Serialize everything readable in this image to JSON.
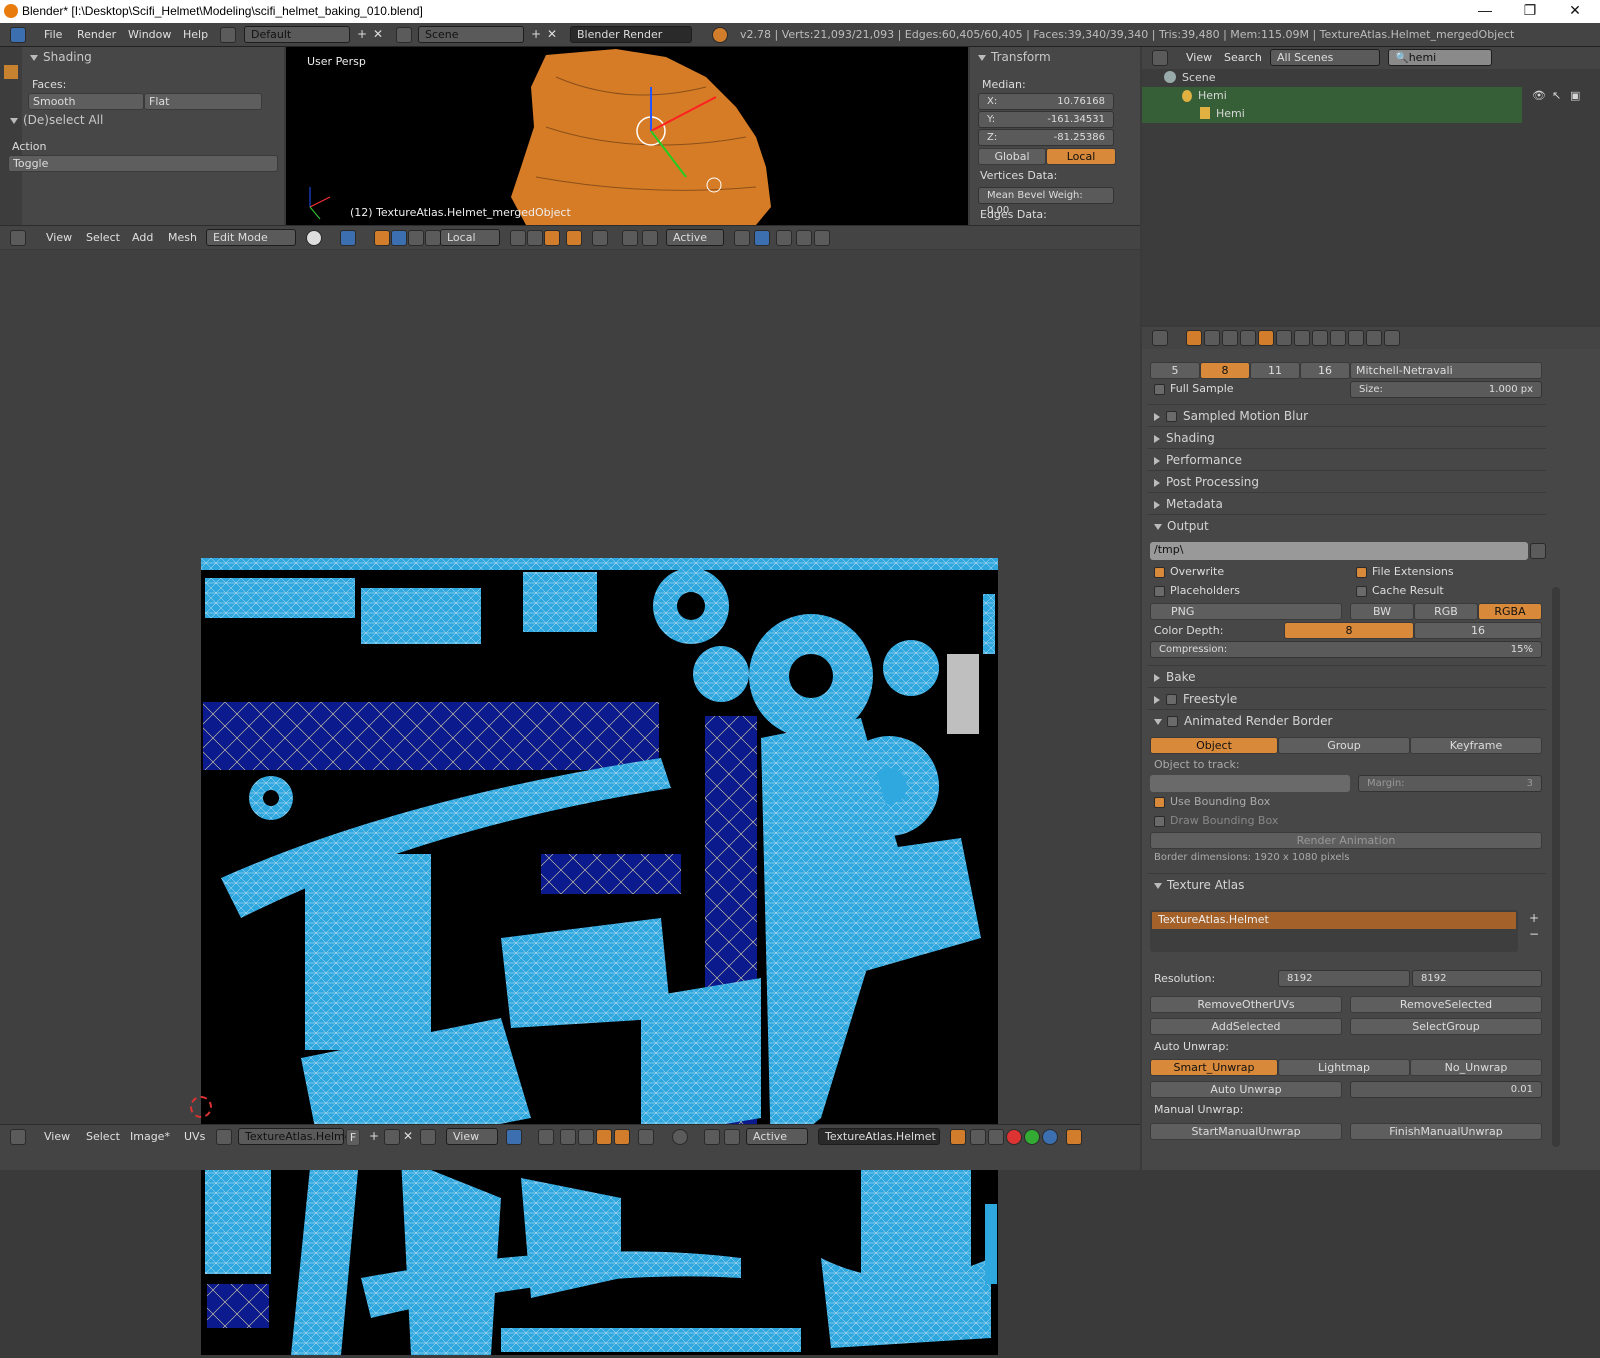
{
  "window": {
    "title": "Blender* [I:\\Desktop\\Scifi_Helmet\\Modeling\\scifi_helmet_baking_010.blend]"
  },
  "infobar": {
    "menus": [
      "File",
      "Render",
      "Window",
      "Help"
    ],
    "layout": "Default",
    "scene": "Scene",
    "engine": "Blender Render",
    "stats": "v2.78 | Verts:21,093/21,093 | Edges:60,405/60,405 | Faces:39,340/39,340 | Tris:39,480 | Mem:115.09M | TextureAtlas.Helmet_mergedObject"
  },
  "tool_panel": {
    "shading_title": "Shading",
    "faces_label": "Faces:",
    "smooth": "Smooth",
    "flat": "Flat",
    "deselect_title": "(De)select All",
    "action_label": "Action",
    "action_value": "Toggle"
  },
  "viewport": {
    "label": "User Persp",
    "object_label": "(12) TextureAtlas.Helmet_mergedObject"
  },
  "transform": {
    "title": "Transform",
    "median": "Median:",
    "x_label": "X:",
    "x": "10.76168",
    "y_label": "Y:",
    "y": "-161.34531",
    "z_label": "Z:",
    "z": "-81.25386",
    "global": "Global",
    "local": "Local",
    "vertices_data": "Vertices Data:",
    "bevel_label": "Mean Bevel Weigh:",
    "bevel": "0.00",
    "edges_data": "Edges Data:"
  },
  "header3d": {
    "view": "View",
    "select": "Select",
    "add": "Add",
    "mesh": "Mesh",
    "mode": "Edit Mode",
    "orientation": "Local",
    "pivot": "Active"
  },
  "outliner": {
    "view": "View",
    "search": "Search",
    "filter": "All Scenes",
    "query": "hemi",
    "scene": "Scene",
    "lamp": "Hemi",
    "lamp_data": "Hemi"
  },
  "props": {
    "aa_values": [
      "5",
      "8",
      "11",
      "16"
    ],
    "aa_filter": "Mitchell-Netravali",
    "full_sample": "Full Sample",
    "size_label": "Size:",
    "size": "1.000 px",
    "sections": [
      "Sampled Motion Blur",
      "Shading",
      "Performance",
      "Post Processing",
      "Metadata"
    ],
    "output": {
      "title": "Output",
      "path": "/tmp\\",
      "overwrite": "Overwrite",
      "file_ext": "File Extensions",
      "placeholders": "Placeholders",
      "cache": "Cache Result",
      "format": "PNG",
      "bw": "BW",
      "rgb": "RGB",
      "rgba": "RGBA",
      "depth_label": "Color Depth:",
      "d8": "8",
      "d16": "16",
      "compression_label": "Compression:",
      "compression": "15%"
    },
    "bake": "Bake",
    "freestyle": "Freestyle",
    "arb": {
      "title": "Animated Render Border",
      "object": "Object",
      "group": "Group",
      "keyframe": "Keyframe",
      "track": "Object to track:",
      "margin_label": "Margin:",
      "margin": "3",
      "use_bbox": "Use Bounding Box",
      "draw_bbox": "Draw Bounding Box",
      "render_anim": "Render Animation",
      "dims": "Border dimensions: 1920 x 1080 pixels"
    },
    "atlas": {
      "title": "Texture Atlas",
      "item": "TextureAtlas.Helmet",
      "res_label": "Resolution:",
      "res_x": "8192",
      "res_y": "8192",
      "remove_others": "RemoveOtherUVs",
      "remove_sel": "RemoveSelected",
      "add_sel": "AddSelected",
      "select_group": "SelectGroup",
      "auto_unwrap_label": "Auto Unwrap:",
      "smart": "Smart_Unwrap",
      "lightmap": "Lightmap",
      "no_unwrap": "No_Unwrap",
      "auto_unwrap": "Auto Unwrap",
      "margin": "0.01",
      "manual_label": "Manual Unwrap:",
      "start": "StartManualUnwrap",
      "finish": "FinishManualUnwrap"
    }
  },
  "uvheader": {
    "view": "View",
    "select": "Select",
    "image": "Image*",
    "uvs": "UVs",
    "image_name": "TextureAtlas.Helmet",
    "f": "F",
    "view2": "View",
    "pivot": "Active",
    "object": "TextureAtlas.Helmet"
  },
  "colors": {
    "accent": "#d8893a",
    "uv_blue": "#2fa8e0",
    "uv_dark": "#0b1a8c"
  }
}
